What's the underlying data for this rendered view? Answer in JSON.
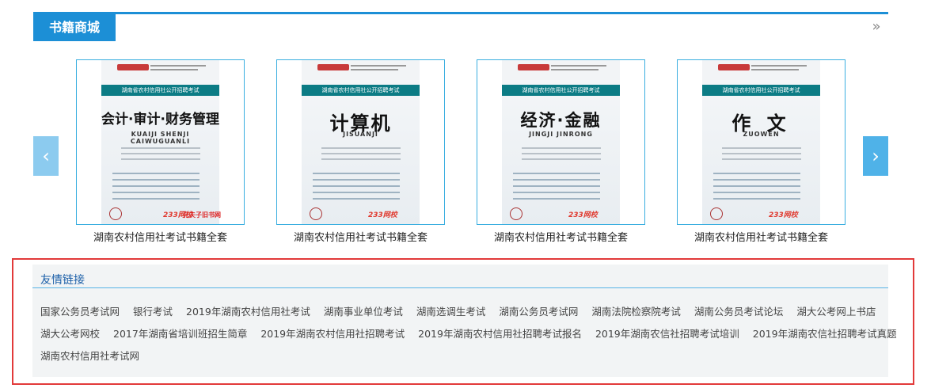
{
  "section": {
    "title": "书籍商城",
    "more_glyph": "»"
  },
  "carousel": {
    "prev_glyph": "‹",
    "next_glyph": "›",
    "books": [
      {
        "caption": "湖南农村信用社考试书籍全套",
        "cover_title": "会计·审计·财务管理",
        "cover_pinyin": "KUAIJI   SHENJI   CAIWUGUANLI",
        "band_text": "湖南省农村信用社公开招聘考试",
        "corner_text": "孔夫子旧书网"
      },
      {
        "caption": "湖南农村信用社考试书籍全套",
        "cover_title": "计算机",
        "cover_pinyin": "JISUANJI",
        "band_text": "湖南省农村信用社公开招聘考试",
        "corner_text": ""
      },
      {
        "caption": "湖南农村信用社考试书籍全套",
        "cover_title": "经济·金融",
        "cover_pinyin": "JINGJI   JINRONG",
        "band_text": "湖南省农村信用社公开招聘考试",
        "corner_text": ""
      },
      {
        "caption": "湖南农村信用社考试书籍全套",
        "cover_title": "作 文",
        "cover_pinyin": "ZUOWEN",
        "band_text": "湖南省农村信用社公开招聘考试",
        "corner_text": ""
      }
    ],
    "brand": "233网校"
  },
  "links": {
    "title": "友情链接",
    "rows": [
      [
        "国家公务员考试网",
        "银行考试",
        "2019年湖南农村信用社考试",
        "湖南事业单位考试",
        "湖南选调生考试",
        "湖南公务员考试网",
        "湖南法院检察院考试",
        "湖南公务员考试论坛",
        "湖大公考网上书店"
      ],
      [
        "湖大公考网校",
        "2017年湖南省培训班招生简章",
        "2019年湖南农村信用社招聘考试",
        "2019年湖南农村信用社招聘考试报名",
        "2019年湖南农信社招聘考试培训",
        "2019年湖南农信社招聘考试真题"
      ],
      [
        "湖南农村信用社考试网"
      ]
    ]
  }
}
